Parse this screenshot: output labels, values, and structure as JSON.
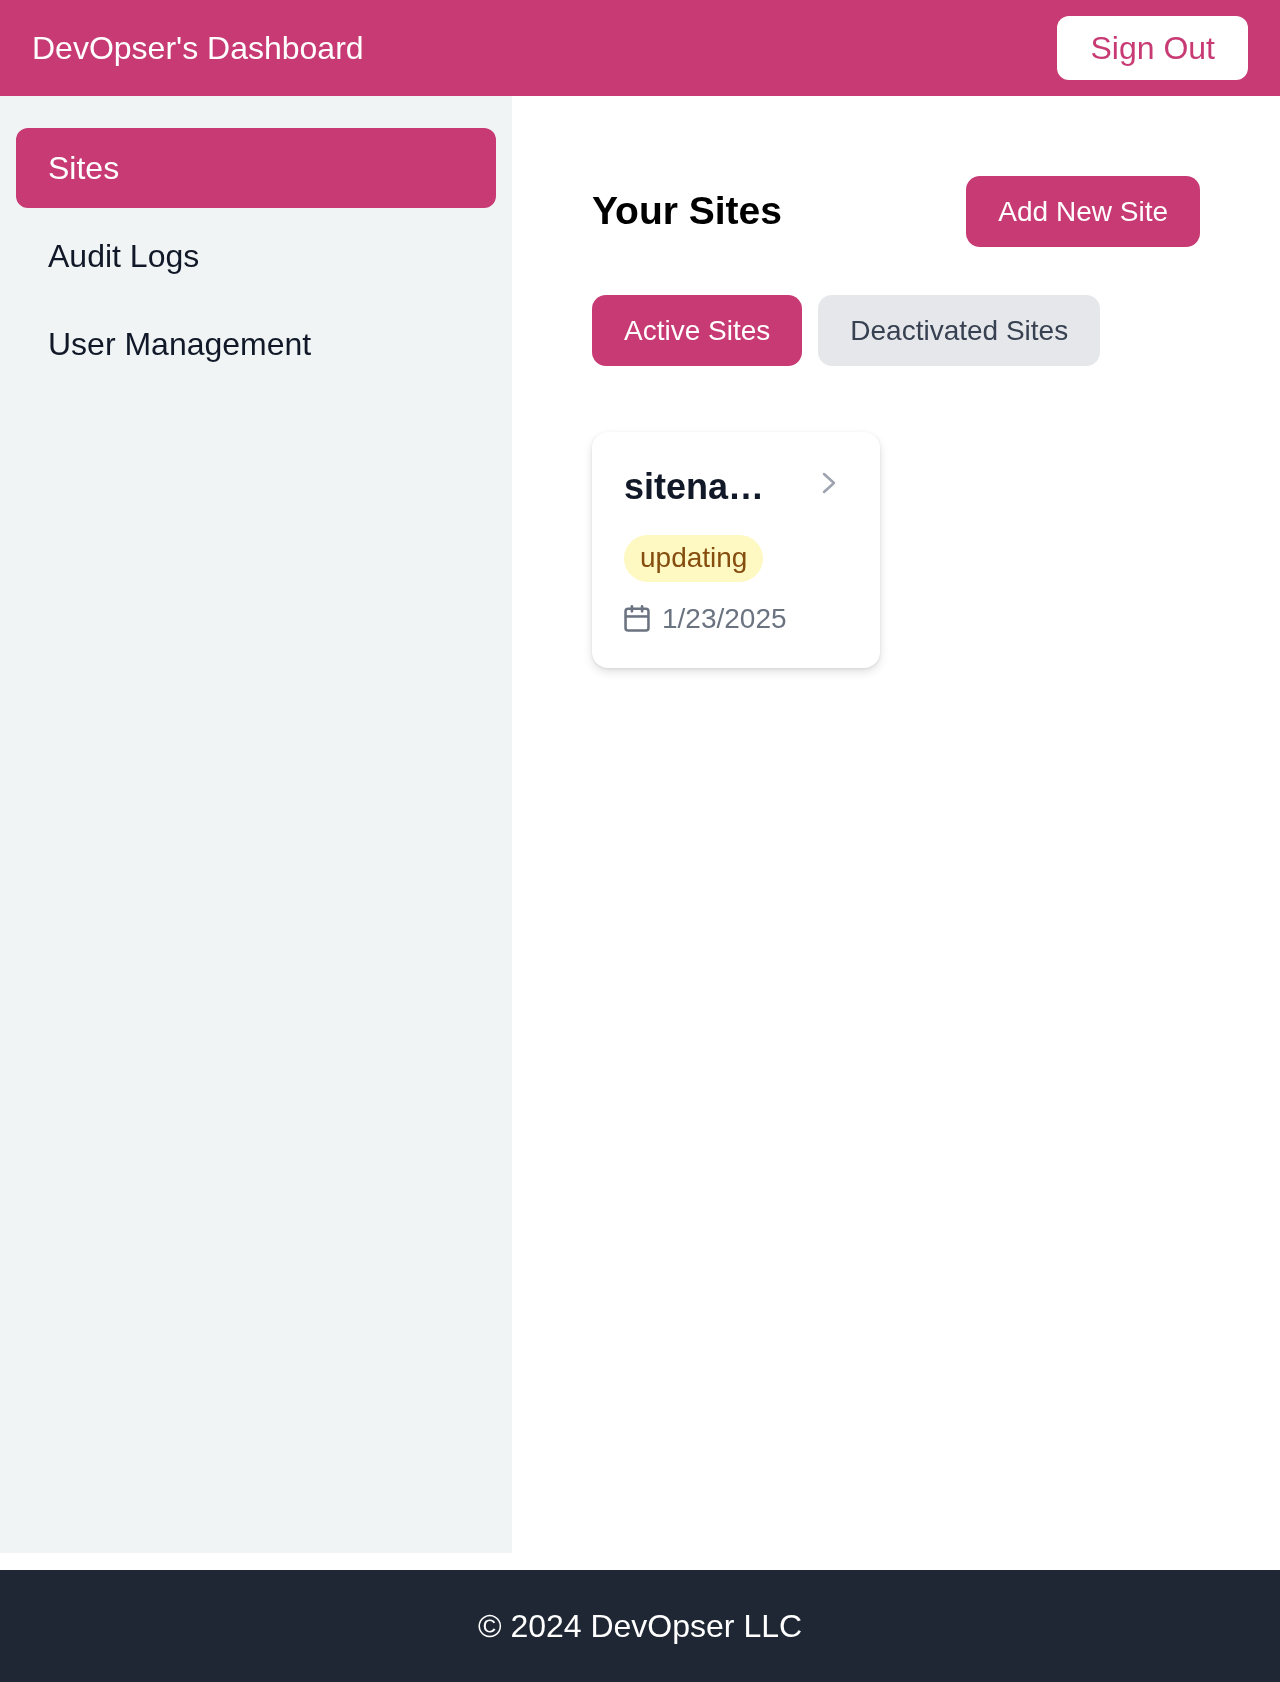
{
  "header": {
    "title": "DevOpser's Dashboard",
    "sign_out": "Sign Out"
  },
  "sidebar": {
    "items": [
      {
        "label": "Sites",
        "selected": true
      },
      {
        "label": "Audit Logs",
        "selected": false
      },
      {
        "label": "User Management",
        "selected": false
      }
    ]
  },
  "main": {
    "heading": "Your Sites",
    "add_button": "Add New Site",
    "tabs": [
      {
        "label": "Active Sites",
        "selected": true
      },
      {
        "label": "Deactivated Sites",
        "selected": false
      }
    ],
    "sites": [
      {
        "name": "sitena…",
        "status": "updating",
        "color": "#fef9c3",
        "date": "1/23/2025"
      }
    ]
  },
  "footer": {
    "text": "© 2024 DevOpser LLC"
  }
}
